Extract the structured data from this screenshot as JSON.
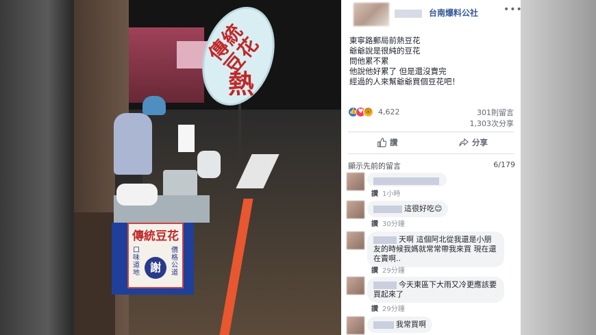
{
  "post": {
    "page_name": "台南爆料公社",
    "more_icon": "more-options-icon",
    "text_lines": [
      "東寧路郵局前熱豆花",
      "爺爺說是很純的豆花",
      "問他累不累",
      "他說他好累了 但是還沒賣完",
      "經過的人來幫爺爺買個豆花吧！"
    ],
    "reaction_count": "4,622",
    "comment_count": "301則留言",
    "share_count": "1,303次分享",
    "like_label": "讚",
    "share_label": "分享"
  },
  "photo": {
    "sign_text": "傳統豆花",
    "sign_big": "熱",
    "cart_title": "傳統豆花",
    "cart_left": "口味道地",
    "cart_right": "價格公道",
    "cart_center": "謝"
  },
  "comments_section": {
    "show_previous": "顯示先前的留言",
    "pager": "6/179",
    "comments": [
      {
        "text": "",
        "like": "讚",
        "time": "1小時"
      },
      {
        "text": "這很好吃😊",
        "like": "讚",
        "time": "30分鐘"
      },
      {
        "text": "天啊 這個阿北從我還是小朋友的時候我媽就常常帶我來買 現在還在賣啊..",
        "like": "讚",
        "time": "29分鐘"
      },
      {
        "text": "今天東區下大雨又冷更應該要買起來了",
        "like": "讚",
        "time": "29分鐘"
      },
      {
        "text": "我常買啊",
        "like": "",
        "time": ""
      }
    ]
  },
  "colors": {
    "link": "#365899",
    "sign_red": "#c02828",
    "cart_blue": "#1f3f9a"
  }
}
